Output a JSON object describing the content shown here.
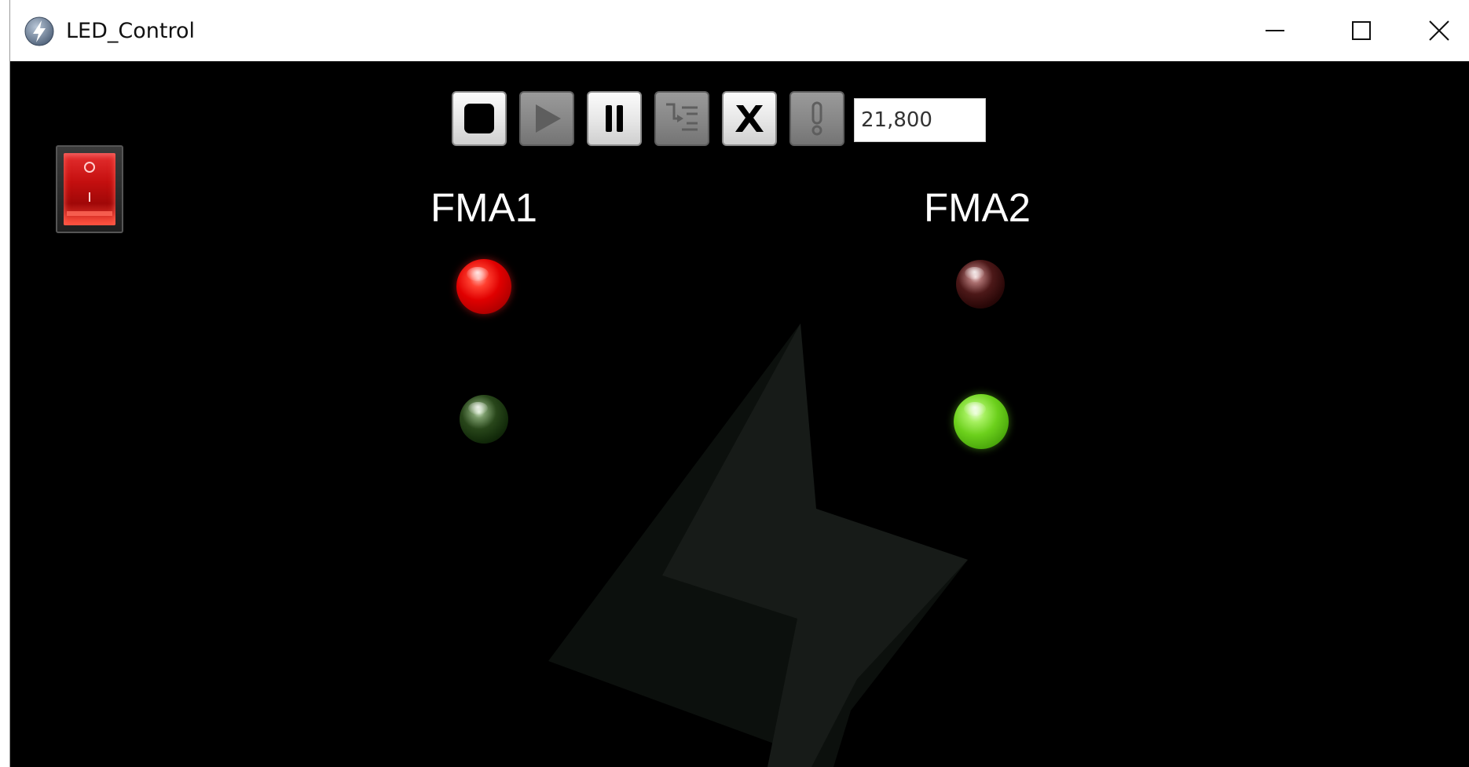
{
  "window": {
    "title": "LED_Control",
    "icon": "lightning-bolt-icon",
    "controls": [
      "minimize-icon",
      "maximize-icon",
      "close-icon"
    ]
  },
  "toolbar": {
    "buttons": [
      {
        "name": "stop",
        "icon": "stop-icon",
        "enabled": true
      },
      {
        "name": "run",
        "icon": "play-icon",
        "enabled": false
      },
      {
        "name": "pause",
        "icon": "pause-icon",
        "enabled": true
      },
      {
        "name": "step",
        "icon": "step-into-icon",
        "enabled": false
      },
      {
        "name": "abort",
        "icon": "x-icon",
        "enabled": true
      },
      {
        "name": "highlight",
        "icon": "exclamation-icon",
        "enabled": false
      }
    ],
    "delay_value": "21,800"
  },
  "power_switch": {
    "state": "on",
    "color": "#d01010"
  },
  "groups": [
    {
      "label": "FMA1",
      "red_led": {
        "lit": true,
        "color": "#e00000"
      },
      "green_led": {
        "lit": false,
        "color": "#28461a"
      }
    },
    {
      "label": "FMA2",
      "red_led": {
        "lit": false,
        "color": "#4c1818"
      },
      "green_led": {
        "lit": true,
        "color": "#6cd01c"
      }
    }
  ],
  "theme": {
    "background": "#000000",
    "watermark_color": "#0c100d",
    "label_color": "#ffffff"
  }
}
